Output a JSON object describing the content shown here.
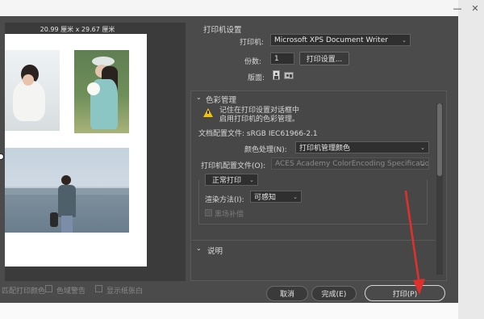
{
  "preview": {
    "dimensions": "20.99 厘米 x 29.67 厘米",
    "bottom_options": [
      "匹配打印颜色",
      "色域警告",
      "显示纸张白"
    ]
  },
  "printer_settings": {
    "section_title": "打印机设置",
    "printer_label": "打印机:",
    "printer_value": "Microsoft XPS Document Writer",
    "copies_label": "份数:",
    "copies_value": "1",
    "print_settings_button": "打印设置...",
    "layout_label": "版面:"
  },
  "color_management": {
    "section_title": "色彩管理",
    "warning_line1": "记住在打印设置对话框中",
    "warning_line2": "启用打印机的色彩管理。",
    "doc_profile": "文档配置文件: sRGB IEC61966-2.1",
    "color_handling_label": "颜色处理(N):",
    "color_handling_value": "打印机管理颜色",
    "printer_profile_label": "打印机配置文件(O):",
    "printer_profile_value": "ACES Academy ColorEncoding Specification...",
    "print_mode_value": "正常打印",
    "rendering_intent_label": "渲染方法(I):",
    "rendering_intent_value": "可感知",
    "black_point_label": "黑场补偿"
  },
  "description": {
    "section_title": "说明"
  },
  "footer": {
    "cancel": "取消",
    "done": "完成(E)",
    "print": "打印(P)"
  },
  "colors": {
    "dialog_bg": "#4b4b4b",
    "preview_bg": "#3b3b3b",
    "arrow": "#e0302c",
    "warning": "#f2c200"
  }
}
